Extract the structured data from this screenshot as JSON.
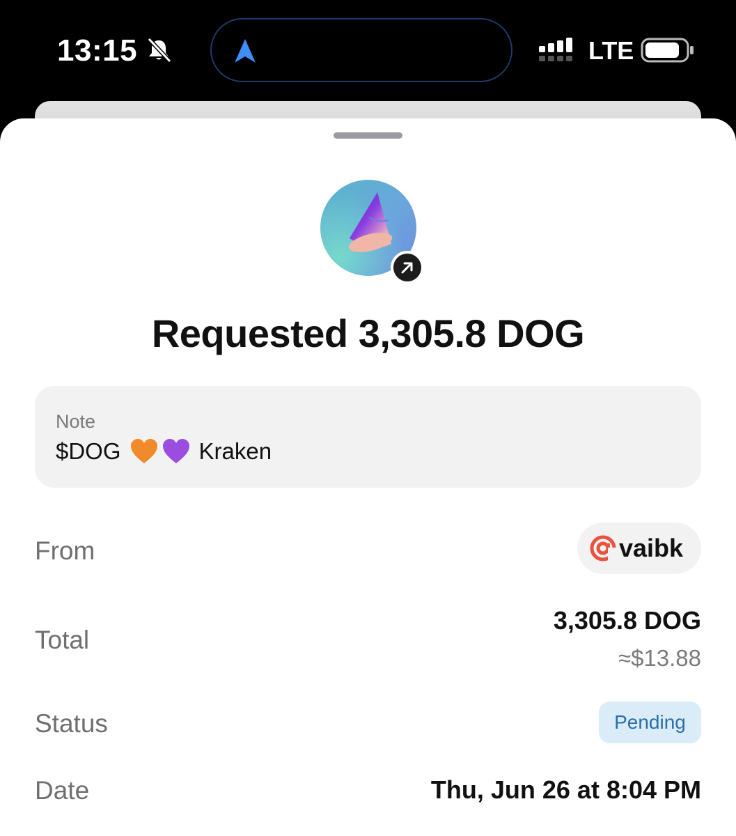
{
  "status_bar": {
    "time": "13:15",
    "network": "LTE"
  },
  "icons": {
    "silent": "bell-slash-icon",
    "navigation": "location-arrow-icon",
    "signal": "cellular-signal-icon",
    "battery": "battery-icon",
    "avatar": "party-cone-icon",
    "link": "arrow-up-right-icon",
    "user_handle": "at-sign-icon"
  },
  "transaction": {
    "title": "Requested 3,305.8 DOG",
    "note": {
      "label": "Note",
      "text_prefix": "$DOG",
      "text_suffix": "Kraken"
    },
    "from": {
      "label": "From",
      "username": "vaibk"
    },
    "total": {
      "label": "Total",
      "amount": "3,305.8 DOG",
      "fiat": "≈$13.88"
    },
    "status": {
      "label": "Status",
      "value": "Pending"
    },
    "date": {
      "label": "Date",
      "value": "Thu, Jun 26 at 8:04 PM"
    }
  },
  "colors": {
    "status_badge_bg": "#d9ecf8",
    "status_badge_text": "#2a6fa8",
    "at_icon": "#e8523f",
    "orange_heart": "#f08a2a",
    "purple_heart": "#9b4de0"
  }
}
